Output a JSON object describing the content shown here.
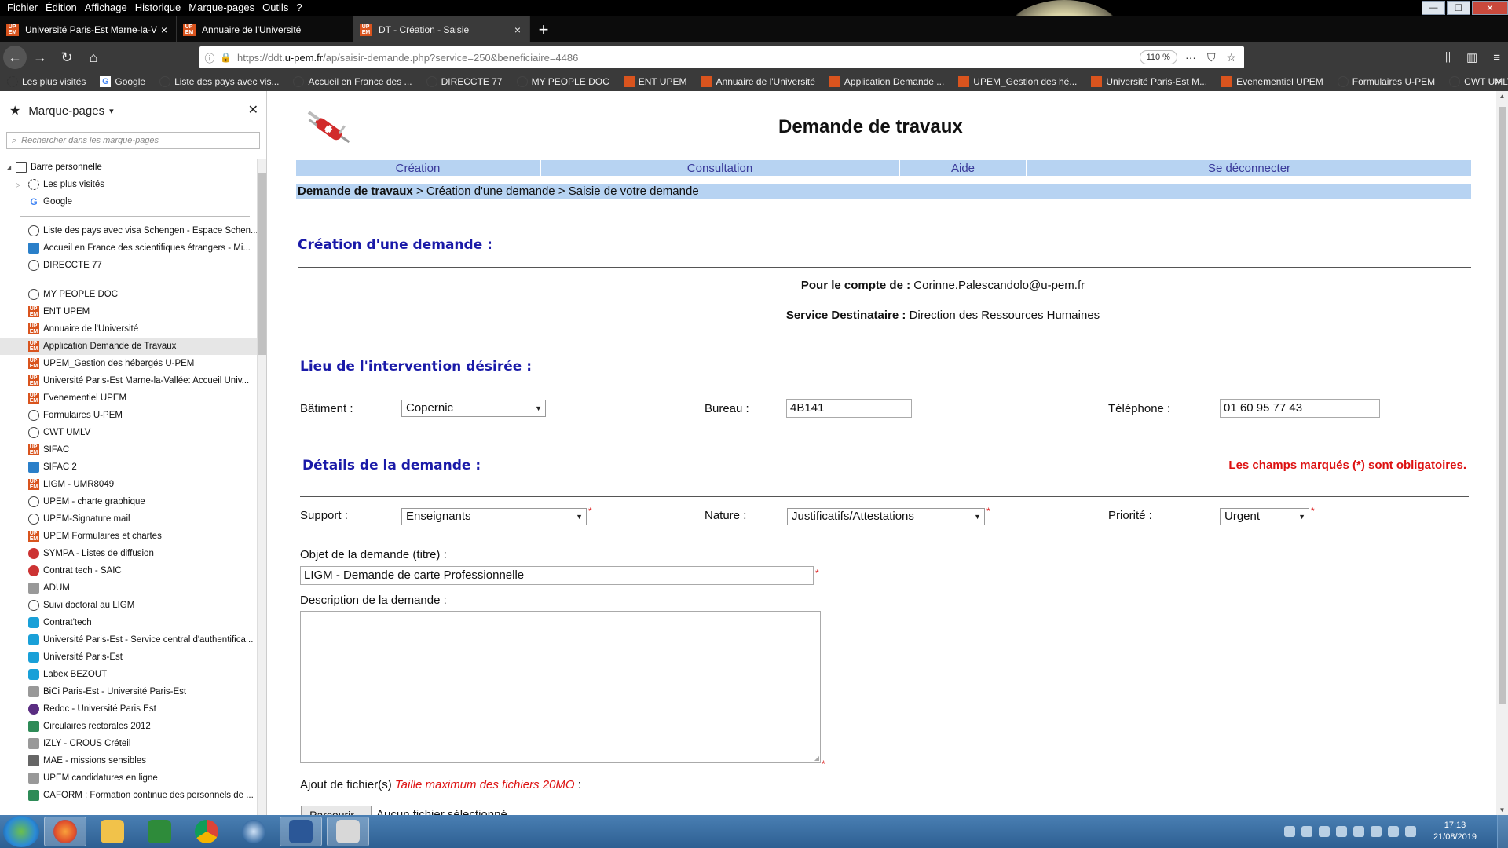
{
  "menubar": [
    "Fichier",
    "Édition",
    "Affichage",
    "Historique",
    "Marque-pages",
    "Outils",
    "?"
  ],
  "tabs": [
    {
      "title": "Université Paris-Est Marne-la-V",
      "active": false
    },
    {
      "title": "Annuaire de l'Université",
      "active": false
    },
    {
      "title": "DT - Création - Saisie",
      "active": true
    }
  ],
  "url": {
    "prefix": "https://ddt.",
    "host": "u-pem.fr",
    "path": "/ap/saisir-demande.php?service=250&beneficiaire=4486",
    "zoom": "110 %"
  },
  "bookmarks_toolbar": [
    {
      "label": "Les plus visités",
      "icon": "gear"
    },
    {
      "label": "Google",
      "icon": "g"
    },
    {
      "label": "Liste des pays avec vis...",
      "icon": "globe"
    },
    {
      "label": "Accueil en France des ...",
      "icon": "globe"
    },
    {
      "label": "DIRECCTE 77",
      "icon": "globe"
    },
    {
      "label": "MY PEOPLE DOC",
      "icon": "globe"
    },
    {
      "label": "ENT UPEM",
      "icon": "upem"
    },
    {
      "label": "Annuaire de l'Université",
      "icon": "upem"
    },
    {
      "label": "Application Demande ...",
      "icon": "upem"
    },
    {
      "label": "UPEM_Gestion des hé...",
      "icon": "upem"
    },
    {
      "label": "Université Paris-Est M...",
      "icon": "upem"
    },
    {
      "label": "Evenementiel UPEM",
      "icon": "upem"
    },
    {
      "label": "Formulaires U-PEM",
      "icon": "globe"
    },
    {
      "label": "CWT UMLV",
      "icon": "globe"
    }
  ],
  "sidebar": {
    "title": "Marque-pages",
    "search_placeholder": "Rechercher dans les marque-pages",
    "root": "Barre personnelle",
    "group1": [
      {
        "label": "Les plus visités",
        "icon": "gear"
      },
      {
        "label": "Google",
        "icon": "g"
      }
    ],
    "group2": [
      {
        "label": "Liste des pays avec visa Schengen - Espace Schen...",
        "icon": "globe"
      },
      {
        "label": "Accueil en France des scientifiques étrangers - Mi...",
        "icon": "blue"
      },
      {
        "label": "DIRECCTE 77",
        "icon": "globe"
      }
    ],
    "group3": [
      {
        "label": "MY PEOPLE DOC",
        "icon": "globe"
      },
      {
        "label": "ENT UPEM",
        "icon": "upem"
      },
      {
        "label": "Annuaire de l'Université",
        "icon": "upem"
      },
      {
        "label": "Application Demande de Travaux",
        "icon": "upem",
        "selected": true
      },
      {
        "label": "UPEM_Gestion des hébergés U-PEM",
        "icon": "upem"
      },
      {
        "label": "Université Paris-Est Marne-la-Vallée: Accueil Univ...",
        "icon": "upem"
      },
      {
        "label": "Evenementiel UPEM",
        "icon": "upem"
      },
      {
        "label": "Formulaires U-PEM",
        "icon": "globe"
      },
      {
        "label": "CWT UMLV",
        "icon": "globe"
      },
      {
        "label": "SIFAC",
        "icon": "upem"
      },
      {
        "label": "SIFAC 2",
        "icon": "blue"
      },
      {
        "label": "LIGM - UMR8049",
        "icon": "upem"
      },
      {
        "label": "UPEM - charte graphique",
        "icon": "globe"
      },
      {
        "label": "UPEM-Signature mail",
        "icon": "globe"
      },
      {
        "label": "UPEM Formulaires et chartes",
        "icon": "upem"
      },
      {
        "label": "SYMPA - Listes de diffusion",
        "icon": "red"
      },
      {
        "label": "Contrat tech - SAIC",
        "icon": "red"
      },
      {
        "label": "ADUM",
        "icon": "grey"
      },
      {
        "label": "Suivi doctoral au LIGM",
        "icon": "globe"
      },
      {
        "label": "Contrat'tech",
        "icon": "hex"
      },
      {
        "label": "Université Paris-Est - Service central d'authentifica...",
        "icon": "hex"
      },
      {
        "label": "Université Paris-Est",
        "icon": "hex"
      },
      {
        "label": "Labex BEZOUT",
        "icon": "hex"
      },
      {
        "label": "BiCi Paris-Est - Université Paris-Est",
        "icon": "grey"
      },
      {
        "label": "Redoc - Université Paris Est",
        "icon": "purple"
      },
      {
        "label": "Circulaires rectorales 2012",
        "icon": "green"
      },
      {
        "label": "IZLY - CROUS Créteil",
        "icon": "grey"
      },
      {
        "label": "MAE - missions sensibles",
        "icon": "folder"
      },
      {
        "label": "UPEM candidatures en ligne",
        "icon": "grey"
      },
      {
        "label": "CAFORM : Formation continue des personnels de ...",
        "icon": "green"
      }
    ]
  },
  "page": {
    "title": "Demande de travaux",
    "nav": [
      "Création",
      "Consultation",
      "Aide",
      "Se déconnecter"
    ],
    "breadcrumb_root": "Demande de travaux",
    "breadcrumb_rest": " > Création d'une demande > Saisie de votre demande",
    "section_creation": "Création d'une demande :",
    "account_label": "Pour le compte de :",
    "account_value": "Corinne.Palescandolo@u-pem.fr",
    "service_label": "Service Destinataire :",
    "service_value": "Direction des Ressources Humaines",
    "section_lieu": "Lieu de l'intervention désirée :",
    "batiment_label": "Bâtiment :",
    "batiment_value": "Copernic",
    "bureau_label": "Bureau :",
    "bureau_value": "4B141",
    "telephone_label": "Téléphone :",
    "telephone_value": "01 60 95 77 43",
    "section_details": "Détails de la demande :",
    "required_note": "Les champs marqués (*) sont obligatoires.",
    "support_label": "Support :",
    "support_value": "Enseignants",
    "nature_label": "Nature :",
    "nature_value": "Justificatifs/Attestations",
    "priorite_label": "Priorité :",
    "priorite_value": "Urgent",
    "objet_label": "Objet de la demande (titre) :",
    "objet_value": "LIGM - Demande de carte Professionnelle",
    "description_label": "Description de la demande :",
    "description_value": "",
    "fichier_label": "Ajout de fichier(s)",
    "fichier_hint": "Taille maximum des fichiers 20MO",
    "fichier_colon": " :",
    "browse_label": "Parcourir...",
    "nofile_label": "Aucun fichier sélectionné.",
    "required_mark": "*"
  },
  "taskbar": {
    "time": "17:13",
    "date": "21/08/2019"
  },
  "colors": {
    "nav_bg": "#b7d3f2",
    "section_title": "#1a1aa8",
    "required": "#d11111",
    "upem_orange": "#d9541e"
  }
}
